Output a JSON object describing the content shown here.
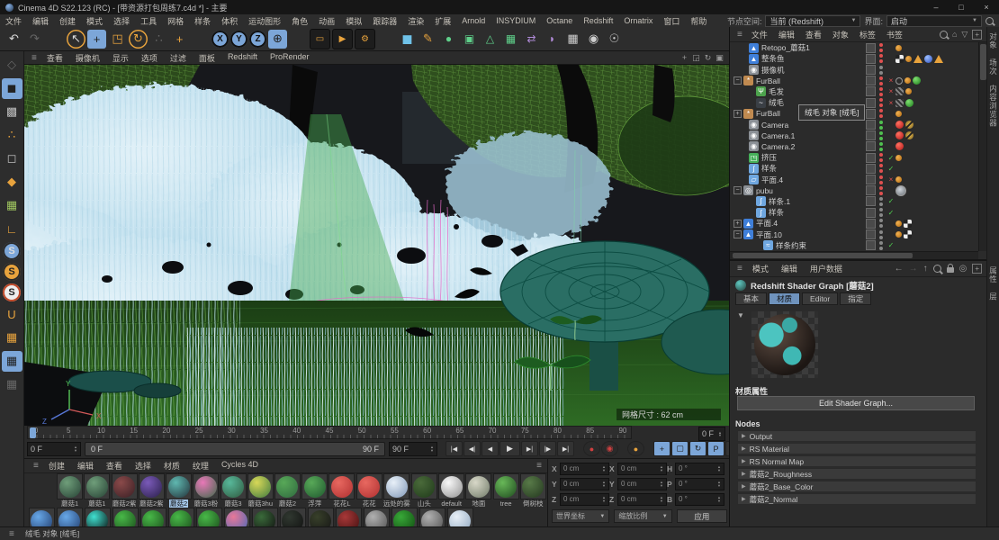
{
  "window": {
    "title": "Cinema 4D S22.123 (RC) - [带资源打包周练7.c4d *] - 主要",
    "minimize": "–",
    "maximize": "□",
    "close": "×"
  },
  "menubar": {
    "items": [
      "文件",
      "编辑",
      "创建",
      "模式",
      "选择",
      "工具",
      "网格",
      "样条",
      "体积",
      "运动图形",
      "角色",
      "动画",
      "模拟",
      "跟踪器",
      "渲染",
      "扩展",
      "Arnold",
      "INSYDIUM",
      "Octane",
      "Redshift",
      "Ornatrix",
      "窗口",
      "帮助"
    ],
    "node_space_label": "节点空间:",
    "node_space_value": "当前 (Redshift)",
    "ui_label": "界面:",
    "ui_value": "启动"
  },
  "toolbar": {
    "items": [
      {
        "n": "undo-icon",
        "g": "↶",
        "c": ""
      },
      {
        "n": "redo-icon",
        "g": "↷",
        "c": "dim"
      },
      {
        "n": "sep",
        "g": "",
        "c": "sep"
      },
      {
        "n": "select-icon",
        "g": "↖",
        "c": "ring"
      },
      {
        "n": "move-icon",
        "g": "+",
        "c": "act"
      },
      {
        "n": "scale-icon",
        "g": "◳",
        "c": "or"
      },
      {
        "n": "rotate-icon",
        "g": "↻",
        "c": "or ring"
      },
      {
        "n": "last-tool-icon",
        "g": "∴",
        "c": "dim"
      },
      {
        "n": "modeling-icon",
        "g": "+",
        "c": "or"
      },
      {
        "n": "sep",
        "g": "",
        "c": "sep"
      },
      {
        "n": "lock-x-icon",
        "g": "X",
        "c": "ax"
      },
      {
        "n": "lock-y-icon",
        "g": "Y",
        "c": "ax"
      },
      {
        "n": "lock-z-icon",
        "g": "Z",
        "c": "ax"
      },
      {
        "n": "coord-system-icon",
        "g": "⊕",
        "c": "act"
      },
      {
        "n": "sep",
        "g": "",
        "c": "sep"
      },
      {
        "n": "render-view-icon",
        "g": "▭",
        "c": "rb"
      },
      {
        "n": "render-icon",
        "g": "▶",
        "c": "rb"
      },
      {
        "n": "render-settings-icon",
        "g": "⚙",
        "c": "rb"
      },
      {
        "n": "sep",
        "g": "",
        "c": "sep"
      },
      {
        "n": "cube-primitive-icon",
        "g": "◼",
        "c": "cube"
      },
      {
        "n": "spline-pen-icon",
        "g": "✎",
        "c": "pen"
      },
      {
        "n": "subdivision-icon",
        "g": "●",
        "c": "gr"
      },
      {
        "n": "generator-icon",
        "g": "▣",
        "c": "gr"
      },
      {
        "n": "deformer-icon",
        "g": "△",
        "c": "gr"
      },
      {
        "n": "cloner-icon",
        "g": "▦",
        "c": "gr"
      },
      {
        "n": "symmetry-icon",
        "g": "⇄",
        "c": "pu"
      },
      {
        "n": "field-icon",
        "g": "◗",
        "c": "pu"
      },
      {
        "n": "floor-icon",
        "g": "▦",
        "c": "gy"
      },
      {
        "n": "camera-icon",
        "g": "◉",
        "c": "gy"
      },
      {
        "n": "light-icon",
        "g": "☉",
        "c": "gy"
      }
    ]
  },
  "palette": {
    "items": [
      {
        "n": "make-editable-icon",
        "g": "◇",
        "c": "dim"
      },
      {
        "n": "model-mode-icon",
        "g": "◼",
        "c": "act"
      },
      {
        "n": "texture-mode-icon",
        "g": "▩",
        "c": ""
      },
      {
        "n": "point-mode-icon",
        "g": "∴",
        "c": "or"
      },
      {
        "n": "edge-mode-icon",
        "g": "◻",
        "c": ""
      },
      {
        "n": "polygon-mode-icon",
        "g": "◆",
        "c": "or"
      },
      {
        "n": "workplane-icon",
        "g": "▦",
        "c": "grn"
      },
      {
        "n": "axis-mode-icon",
        "g": "∟",
        "c": "or"
      },
      {
        "n": "enable-snap-icon",
        "g": "S",
        "c": "scirc act"
      },
      {
        "n": "snap-3d-icon",
        "g": "S",
        "c": "scirc sor"
      },
      {
        "n": "snap-auto-icon",
        "g": "S",
        "c": "scirc swh"
      },
      {
        "n": "magnet-icon",
        "g": "U",
        "c": "or"
      },
      {
        "n": "grid-icon",
        "g": "▦",
        "c": "or"
      },
      {
        "n": "quantize-icon",
        "g": "▦",
        "c": "act"
      },
      {
        "n": "grid-rotate-icon",
        "g": "▦",
        "c": "or dim"
      }
    ]
  },
  "viewport": {
    "menu": [
      "查看",
      "摄像机",
      "显示",
      "选项",
      "过滤",
      "面板",
      "Redshift",
      "ProRender"
    ],
    "icons": [
      {
        "n": "pan-view-icon",
        "g": "+"
      },
      {
        "n": "zoom-view-icon",
        "g": "◲"
      },
      {
        "n": "rotate-view-icon",
        "g": "↻"
      },
      {
        "n": "toggle-view-icon",
        "g": "▣"
      }
    ],
    "grid_size": "网格尺寸 : 62 cm",
    "axis": {
      "x": "X",
      "y": "Y",
      "z": "Z"
    }
  },
  "timeline": {
    "ticks": [
      "0",
      "5",
      "10",
      "15",
      "20",
      "25",
      "30",
      "35",
      "40",
      "45",
      "50",
      "55",
      "60",
      "65",
      "70",
      "75",
      "80",
      "85",
      "90"
    ],
    "current": "0 F",
    "range_start": "0 F",
    "range_end": "90 F",
    "end_field": "90 F",
    "right_field": "0 F"
  },
  "transport": {
    "items": [
      {
        "n": "goto-start-button",
        "g": "|◀",
        "c": ""
      },
      {
        "n": "prev-key-button",
        "g": "◀|",
        "c": ""
      },
      {
        "n": "prev-frame-button",
        "g": "◀",
        "c": ""
      },
      {
        "n": "play-button",
        "g": "▶",
        "c": "play"
      },
      {
        "n": "next-frame-button",
        "g": "▶|",
        "c": ""
      },
      {
        "n": "next-key-button",
        "g": "|▶",
        "c": ""
      },
      {
        "n": "goto-end-button",
        "g": "▶|",
        "c": ""
      },
      {
        "n": "record-button",
        "g": "●",
        "c": "rec gap"
      },
      {
        "n": "autokey-button",
        "g": "◉",
        "c": "rec"
      },
      {
        "n": "keyframe-button",
        "g": "●",
        "c": "keyc gap"
      },
      {
        "n": "key-position-button",
        "g": "+",
        "c": "kb on gap"
      },
      {
        "n": "key-scale-button",
        "g": "▢",
        "c": "kb on"
      },
      {
        "n": "key-rotation-button",
        "g": "↻",
        "c": "kb on"
      },
      {
        "n": "key-parameter-button",
        "g": "P",
        "c": "kb on"
      },
      {
        "n": "key-pla-button",
        "g": "∷",
        "c": "kb"
      },
      {
        "n": "sound-button",
        "g": "◢",
        "c": "gap"
      },
      {
        "n": "film-button",
        "g": "▤",
        "c": "on"
      }
    ]
  },
  "materials": {
    "menu": [
      "创建",
      "编辑",
      "查看",
      "选择",
      "材质",
      "纹理",
      "Cycles 4D"
    ],
    "row1": [
      {
        "name": "蘑菇1",
        "c1": "#6f9e7a",
        "c2": "#274235",
        "nc": ""
      },
      {
        "name": "蘑菇1",
        "c1": "#6f9e7a",
        "c2": "#274235",
        "nc": ""
      },
      {
        "name": "蘑菇2紫",
        "c1": "#8a4a4a",
        "c2": "#3a1f24",
        "nc": ""
      },
      {
        "name": "蘑菇2紫",
        "c1": "#7a5ab8",
        "c2": "#2a1f4a",
        "nc": ""
      },
      {
        "name": "蘑菇2",
        "c1": "#5fb8b0",
        "c2": "#23323a",
        "nc": "sel"
      },
      {
        "name": "蘑菇3粉",
        "c1": "#e878b8",
        "c2": "#3f6a4a",
        "nc": ""
      },
      {
        "name": "蘑菇3",
        "c1": "#58b89a",
        "c2": "#2f5a3f",
        "nc": ""
      },
      {
        "name": "蘑菇3hu",
        "c1": "#d8d858",
        "c2": "#3f7a3f",
        "nc": ""
      },
      {
        "name": "蘑菇2",
        "c1": "#58a858",
        "c2": "#2f6a3f",
        "nc": ""
      },
      {
        "name": "浮萍",
        "c1": "#58a858",
        "c2": "#1f5a2f",
        "nc": ""
      },
      {
        "name": "花花L",
        "c1": "#e86860",
        "c2": "#b03030",
        "nc": ""
      },
      {
        "name": "花花",
        "c1": "#e86860",
        "c2": "#b03030",
        "nc": ""
      },
      {
        "name": "远处的雾",
        "c1": "#e8f0f8",
        "c2": "#8098b8",
        "nc": ""
      },
      {
        "name": "山头",
        "c1": "#4a6a3a",
        "c2": "#1f3a1a",
        "nc": ""
      },
      {
        "name": "default",
        "c1": "#f8f8f8",
        "c2": "#909090",
        "nc": ""
      },
      {
        "name": "地面",
        "c1": "#d8d8c8",
        "c2": "#707a68",
        "nc": ""
      },
      {
        "name": "tree",
        "c1": "#68b858",
        "c2": "#1f4a1f",
        "nc": ""
      },
      {
        "name": "倒树枝",
        "c1": "#587a48",
        "c2": "#24381f",
        "nc": ""
      }
    ],
    "row2": [
      {
        "c1": "#68a8e8",
        "c2": "#1f3a6a"
      },
      {
        "c1": "#68a8e8",
        "c2": "#1f3a6a"
      },
      {
        "c1": "#40e0d0",
        "c2": "#0a0a0a"
      },
      {
        "c1": "#48b848",
        "c2": "#1a4a1a"
      },
      {
        "c1": "#48b848",
        "c2": "#1a4a1a"
      },
      {
        "c1": "#48b848",
        "c2": "#1a4a1a"
      },
      {
        "c1": "#48b848",
        "c2": "#1a4a1a"
      },
      {
        "c1": "#e87898",
        "c2": "#4868b8"
      },
      {
        "c1": "#3a6a3a",
        "c2": "#101010"
      },
      {
        "c1": "#303830",
        "c2": "#101010"
      },
      {
        "c1": "#38402a",
        "c2": "#151515"
      },
      {
        "c1": "#a83838",
        "c2": "#401010"
      },
      {
        "c1": "#b0b0b0",
        "c2": "#505050"
      },
      {
        "c1": "#38a838",
        "c2": "#104a10"
      },
      {
        "c1": "#b0b0b0",
        "c2": "#505050"
      },
      {
        "c1": "#e8f0f8",
        "c2": "#90a8c0"
      }
    ]
  },
  "coords": {
    "fields": [
      {
        "l": "X",
        "v": "0 cm"
      },
      {
        "l": "Y",
        "v": "0 cm"
      },
      {
        "l": "Z",
        "v": "0 cm"
      },
      {
        "l": "X",
        "v": "0 cm"
      },
      {
        "l": "Y",
        "v": "0 cm"
      },
      {
        "l": "Z",
        "v": "0 cm"
      },
      {
        "l": "H",
        "v": "0 °"
      },
      {
        "l": "P",
        "v": "0 °"
      },
      {
        "l": "B",
        "v": "0 °"
      }
    ],
    "mode1": "世界坐标",
    "mode2": "缩放比例",
    "apply": "应用"
  },
  "object_manager": {
    "menu": [
      "文件",
      "编辑",
      "查看",
      "对象",
      "标签",
      "书签"
    ],
    "side_tabs_top": [
      "对象",
      "场次",
      "内容浏览器"
    ],
    "side_tabs_bottom": [
      "属性",
      "层"
    ],
    "rows": [
      {
        "name": "Retopo_蘑菇1",
        "ind": "6",
        "exp": "none",
        "eg": "",
        "ic": "#3f7fd9",
        "ig": "▲",
        "dg": "dred",
        "mg": "",
        "mc": "",
        "t1": "t-dot",
        "t2": "",
        "t3": "",
        "t4": "",
        "t5": ""
      },
      {
        "name": "整条鱼",
        "ind": "6",
        "exp": "none",
        "eg": "",
        "ic": "#3f7fd9",
        "ig": "▲",
        "dg": "dred",
        "mg": "",
        "mc": "",
        "t1": "t-checker",
        "t2": "t-dot",
        "t3": "t-tri",
        "t4": "t-sphb",
        "t5": "t-tri"
      },
      {
        "name": "摄像机",
        "ind": "6",
        "exp": "none",
        "eg": "",
        "ic": "#8b9096",
        "ig": "◉",
        "dg": "dgray",
        "mg": "",
        "mc": "",
        "t1": "",
        "t2": "",
        "t3": "",
        "t4": "",
        "t5": ""
      },
      {
        "name": "FurBall",
        "ind": "0",
        "exp": "",
        "eg": "−",
        "ic": "#c08a50",
        "ig": "*",
        "dg": "dred",
        "mg": "×",
        "mc": "mkr",
        "t1": "t-circ",
        "t2": "t-dot",
        "t3": "t-sphg",
        "t4": "",
        "t5": ""
      },
      {
        "name": "毛发",
        "ind": "14",
        "exp": "none",
        "eg": "",
        "ic": "#4da34d",
        "ig": "Ψ",
        "dg": "dred",
        "mg": "×",
        "mc": "mkr",
        "t1": "t-hatch",
        "t2": "t-dot",
        "t3": "",
        "t4": "",
        "t5": ""
      },
      {
        "name": "绒毛",
        "ind": "14",
        "exp": "none",
        "eg": "",
        "ic": "#3a3f45",
        "ig": "~",
        "dg": "dred",
        "mg": "×",
        "mc": "mkr",
        "t1": "t-hatch",
        "t2": "t-sphg",
        "t3": "",
        "t4": "",
        "t5": ""
      },
      {
        "name": "FurBall",
        "ind": "0",
        "exp": "",
        "eg": "+",
        "ic": "#c08a50",
        "ig": "*",
        "dg": "dred",
        "mg": "",
        "mc": "",
        "t1": "t-dot",
        "t2": "",
        "t3": "",
        "t4": "",
        "t5": ""
      },
      {
        "name": "Camera",
        "ind": "6",
        "exp": "none",
        "eg": "",
        "ic": "#8b9096",
        "ig": "◉",
        "dg": "dgreen",
        "mg": "",
        "mc": "",
        "t1": "t-rsred",
        "t2": "t-ban",
        "t3": "",
        "t4": "",
        "t5": ""
      },
      {
        "name": "Camera.1",
        "ind": "6",
        "exp": "none",
        "eg": "",
        "ic": "#8b9096",
        "ig": "◉",
        "dg": "dgreen",
        "mg": "",
        "mc": "",
        "t1": "t-rsred",
        "t2": "t-ban",
        "t3": "",
        "t4": "",
        "t5": ""
      },
      {
        "name": "Camera.2",
        "ind": "6",
        "exp": "none",
        "eg": "",
        "ic": "#8b9096",
        "ig": "◉",
        "dg": "dgreen",
        "mg": "",
        "mc": "",
        "t1": "t-rsred",
        "t2": "",
        "t3": "",
        "t4": "",
        "t5": ""
      },
      {
        "name": "挤压",
        "ind": "6",
        "exp": "none",
        "eg": "",
        "ic": "#46b05a",
        "ig": "◳",
        "dg": "dred",
        "mg": "✓",
        "mc": "mkg",
        "t1": "t-dot",
        "t2": "",
        "t3": "",
        "t4": "",
        "t5": ""
      },
      {
        "name": "样条",
        "ind": "6",
        "exp": "none",
        "eg": "",
        "ic": "#6fa7e0",
        "ig": "∫",
        "dg": "dred",
        "mg": "✓",
        "mc": "mkg",
        "t1": "",
        "t2": "",
        "t3": "",
        "t4": "",
        "t5": ""
      },
      {
        "name": "平面.4",
        "ind": "6",
        "exp": "none",
        "eg": "",
        "ic": "#6fa7e0",
        "ig": "▱",
        "dg": "dred",
        "mg": "×",
        "mc": "mkr",
        "t1": "t-dot",
        "t2": "",
        "t3": "",
        "t4": "",
        "t5": ""
      },
      {
        "name": "pubu",
        "ind": "0",
        "exp": "",
        "eg": "−",
        "ic": "#8b9096",
        "ig": "◎",
        "dg": "dred",
        "mg": "",
        "mc": "",
        "t1": "t-circg",
        "t2": "",
        "t3": "",
        "t4": "",
        "t5": ""
      },
      {
        "name": "样条.1",
        "ind": "14",
        "exp": "none",
        "eg": "",
        "ic": "#6fa7e0",
        "ig": "∫",
        "dg": "dgray",
        "mg": "✓",
        "mc": "mkg",
        "t1": "",
        "t2": "",
        "t3": "",
        "t4": "",
        "t5": ""
      },
      {
        "name": "样条",
        "ind": "14",
        "exp": "none",
        "eg": "",
        "ic": "#6fa7e0",
        "ig": "∫",
        "dg": "dgray",
        "mg": "✓",
        "mc": "mkg",
        "t1": "",
        "t2": "",
        "t3": "",
        "t4": "",
        "t5": ""
      },
      {
        "name": "平面.4",
        "ind": "0",
        "exp": "",
        "eg": "+",
        "ic": "#3f7fd9",
        "ig": "▲",
        "dg": "dgray",
        "mg": "",
        "mc": "",
        "t1": "t-dot",
        "t2": "t-checker",
        "t3": "",
        "t4": "",
        "t5": ""
      },
      {
        "name": "平面.10",
        "ind": "0",
        "exp": "",
        "eg": "−",
        "ic": "#3f7fd9",
        "ig": "▲",
        "dg": "dgray",
        "mg": "",
        "mc": "",
        "t1": "t-dot",
        "t2": "t-checker",
        "t3": "",
        "t4": "",
        "t5": ""
      },
      {
        "name": "样条约束",
        "ind": "22",
        "exp": "none",
        "eg": "",
        "ic": "#6fa7e0",
        "ig": "≈",
        "dg": "dgray",
        "mg": "✓",
        "mc": "mkg",
        "t1": "",
        "t2": "",
        "t3": "",
        "t4": "",
        "t5": ""
      }
    ]
  },
  "tooltip": "绒毛 对象 [绒毛]",
  "attributes": {
    "menu": [
      "模式",
      "编辑",
      "用户数据"
    ],
    "title": "Redshift Shader Graph [蘑菇2]",
    "tabs": [
      {
        "label": "基本",
        "c": ""
      },
      {
        "label": "材质",
        "c": "sel"
      },
      {
        "label": "Editor",
        "c": ""
      },
      {
        "label": "指定",
        "c": ""
      }
    ],
    "props_label": "材质属性",
    "edit_button": "Edit Shader Graph...",
    "nodes_label": "Nodes",
    "nodes": [
      "Output",
      "RS Material",
      "RS Normal Map",
      "蘑菇2_Roughness",
      "蘑菇2_Base_Color",
      "蘑菇2_Normal"
    ]
  },
  "statusbar": {
    "text": "绒毛 对象 [绒毛]"
  },
  "colors": {
    "accent_blue": "#7ca6d8",
    "accent_orange": "#e8a33d",
    "selection_blue": "#a6c8ea",
    "fur_blue": "#cfe9f4",
    "grass_green": "#2e6b24",
    "mushroom_teal": "#2a6e64"
  }
}
